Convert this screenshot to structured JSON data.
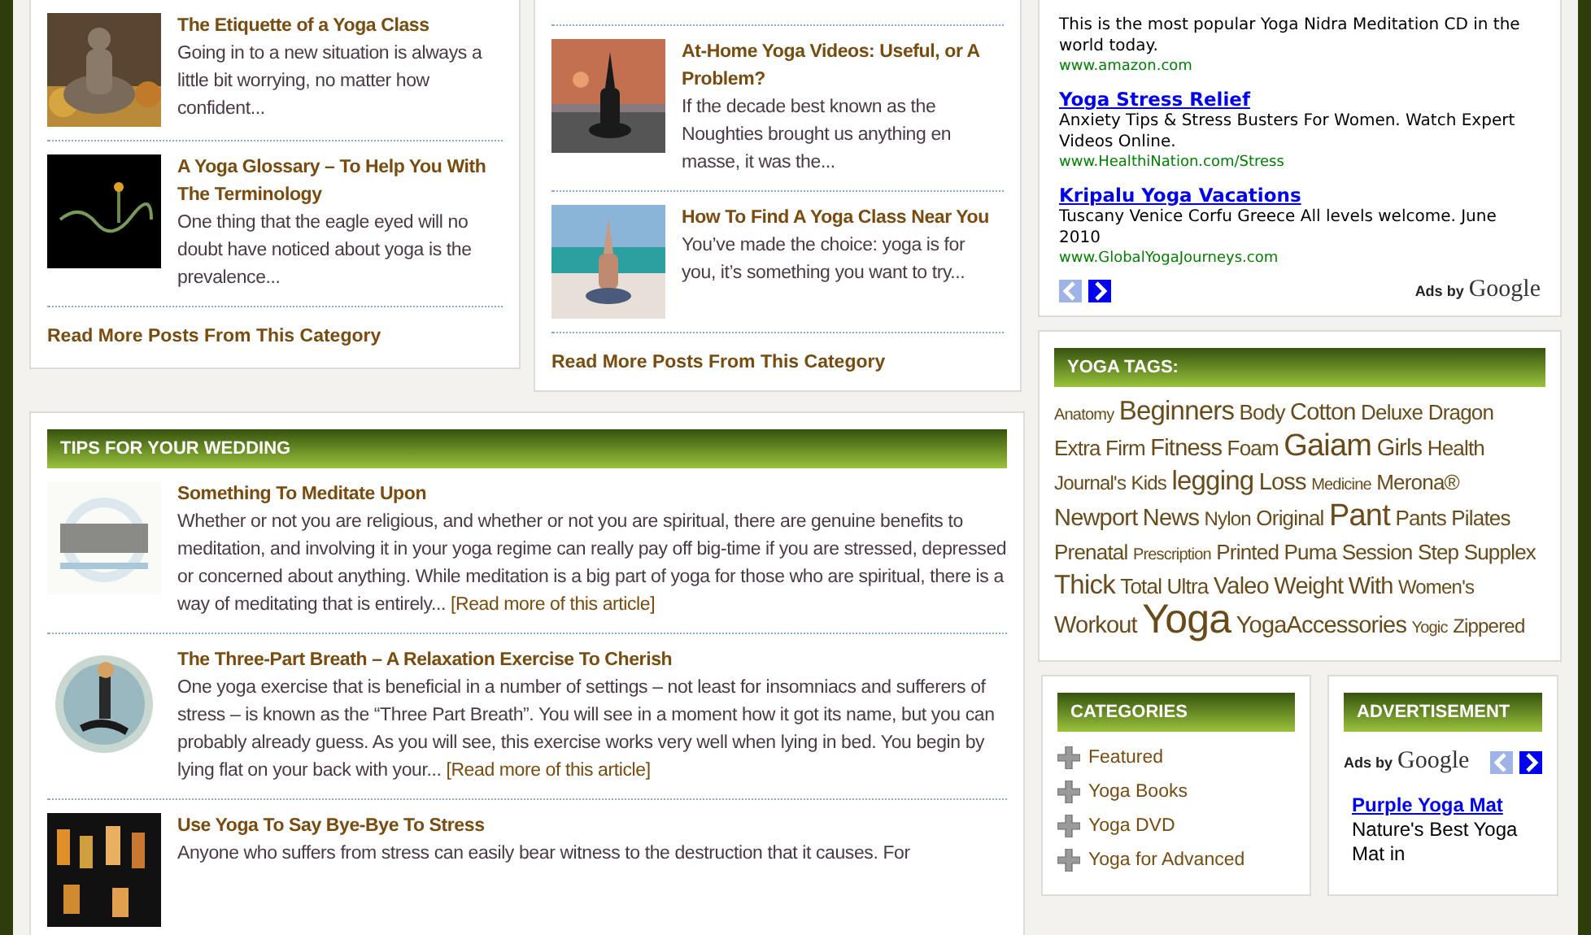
{
  "post_columns": [
    {
      "posts": [
        {
          "title": "The Etiquette of a Yoga Class",
          "excerpt": "Going in to a new situation is always a little bit worrying, no matter how confident..."
        },
        {
          "title": "A Yoga Glossary – To Help You With The Terminology",
          "excerpt": "One thing that the eagle eyed will no doubt have noticed about yoga is the prevalence..."
        }
      ],
      "more_link": "Read More Posts From This Category"
    },
    {
      "posts": [
        {
          "title": "At-Home Yoga Videos: Useful, or A Problem?",
          "excerpt": "If the decade best known as the Noughties brought us anything en masse, it was the..."
        },
        {
          "title": "How To Find A Yoga Class Near You",
          "excerpt": "You’ve made the choice: yoga is for you, it’s something you want to try..."
        }
      ],
      "more_link": "Read More Posts From This Category"
    }
  ],
  "wedding_section": {
    "title": "TIPS FOR YOUR WEDDING",
    "posts": [
      {
        "title": "Something To Meditate Upon",
        "excerpt": "Whether or not you are religious, and whether or not you are spiritual, there are genuine benefits to meditation, and involving it in your yoga regime can really pay off big-time if you are stressed, depressed or concerned about anything. While meditation is a big part of yoga for those who are spiritual, there is a way of meditating that is entirely...",
        "read_more": "[Read more of this article]"
      },
      {
        "title": "The Three-Part Breath – A Relaxation Exercise To Cherish",
        "excerpt": "One yoga exercise that is beneficial in a number of settings – not least for insomniacs and sufferers of stress – is known as the “Three Part Breath”. You will see in a moment how it got its name, but you can probably already guess. As you will see, this exercise works very well when lying in bed. You begin by lying flat on your back with your...",
        "read_more": "[Read more of this article]"
      },
      {
        "title": "Use Yoga To Say Bye-Bye To Stress",
        "excerpt": "Anyone who suffers from stress can easily bear witness to the destruction that it causes. For"
      }
    ]
  },
  "sidebar": {
    "ads": {
      "items": [
        {
          "description": "This is the most popular Yoga Nidra Meditation CD in the world today.",
          "url": "www.amazon.com"
        },
        {
          "title": "Yoga Stress Relief",
          "description": "Anxiety Tips & Stress Busters For Women. Watch Expert Videos Online.",
          "url": "www.HealthiNation.com/Stress"
        },
        {
          "title": "Kripalu Yoga Vacations",
          "description": "Tuscany Venice Corfu Greece All levels welcome. June 2010",
          "url": "www.GlobalYogaJourneys.com"
        }
      ],
      "nav": [
        {
          "kind": "prev",
          "disabled": true
        },
        {
          "kind": "next",
          "disabled": false
        }
      ],
      "ads_by": "Ads by",
      "brand": "Google"
    },
    "tags": {
      "title": "YOGA TAGS:",
      "items": [
        {
          "label": "Anatomy",
          "kind": "tiny"
        },
        {
          "label": "Beginners",
          "kind": "big"
        },
        {
          "label": "Body",
          "kind": "normal"
        },
        {
          "label": "Cotton",
          "kind": "large"
        },
        {
          "label": "Deluxe",
          "kind": "normal"
        },
        {
          "label": "Dragon",
          "kind": "normal"
        },
        {
          "label": "Extra Firm",
          "kind": "normal"
        },
        {
          "label": "Fitness",
          "kind": "large"
        },
        {
          "label": "Foam",
          "kind": "normal"
        },
        {
          "label": "Gaiam",
          "kind": "huge"
        },
        {
          "label": "Girls",
          "kind": "large"
        },
        {
          "label": "Health",
          "kind": "normal"
        },
        {
          "label": "Journal's",
          "kind": "small"
        },
        {
          "label": "Kids",
          "kind": "small"
        },
        {
          "label": "legging",
          "kind": "big"
        },
        {
          "label": "Loss",
          "kind": "large"
        },
        {
          "label": "Medicine",
          "kind": "tiny"
        },
        {
          "label": "Merona®",
          "kind": "normal"
        },
        {
          "label": "Newport",
          "kind": "large"
        },
        {
          "label": "News",
          "kind": "large"
        },
        {
          "label": "Nylon",
          "kind": "small"
        },
        {
          "label": "Original",
          "kind": "normal"
        },
        {
          "label": "Pant",
          "kind": "huge"
        },
        {
          "label": "Pants",
          "kind": "normal"
        },
        {
          "label": "Pilates",
          "kind": "normal"
        },
        {
          "label": "Prenatal",
          "kind": "normal"
        },
        {
          "label": "Prescription",
          "kind": "tiny"
        },
        {
          "label": "Printed",
          "kind": "normal"
        },
        {
          "label": "Puma",
          "kind": "normal"
        },
        {
          "label": "Session",
          "kind": "normal"
        },
        {
          "label": "Step",
          "kind": "normal"
        },
        {
          "label": "Supplex",
          "kind": "normal"
        },
        {
          "label": "Thick",
          "kind": "big"
        },
        {
          "label": "Total",
          "kind": "normal"
        },
        {
          "label": "Ultra",
          "kind": "normal"
        },
        {
          "label": "Valeo",
          "kind": "large"
        },
        {
          "label": "Weight",
          "kind": "large"
        },
        {
          "label": "With",
          "kind": "large"
        },
        {
          "label": "Women's",
          "kind": "small"
        },
        {
          "label": "Workout",
          "kind": "large"
        },
        {
          "label": "Yoga",
          "kind": "giant"
        },
        {
          "label": "YogaAccessories",
          "kind": "large"
        },
        {
          "label": "Yogic",
          "kind": "tiny"
        },
        {
          "label": "Zippered",
          "kind": "small"
        }
      ]
    },
    "categories": {
      "title": "CATEGORIES",
      "items": [
        "Featured",
        "Yoga Books",
        "Yoga DVD",
        "Yoga for Advanced"
      ]
    },
    "advertisement": {
      "title": "ADVERTISEMENT",
      "ads_by": "Ads by",
      "brand": "Google",
      "nav": [
        {
          "kind": "prev",
          "disabled": true
        },
        {
          "kind": "next",
          "disabled": false
        }
      ],
      "ad": {
        "title": "Purple Yoga Mat",
        "description": "Nature's Best Yoga Mat in"
      }
    }
  }
}
